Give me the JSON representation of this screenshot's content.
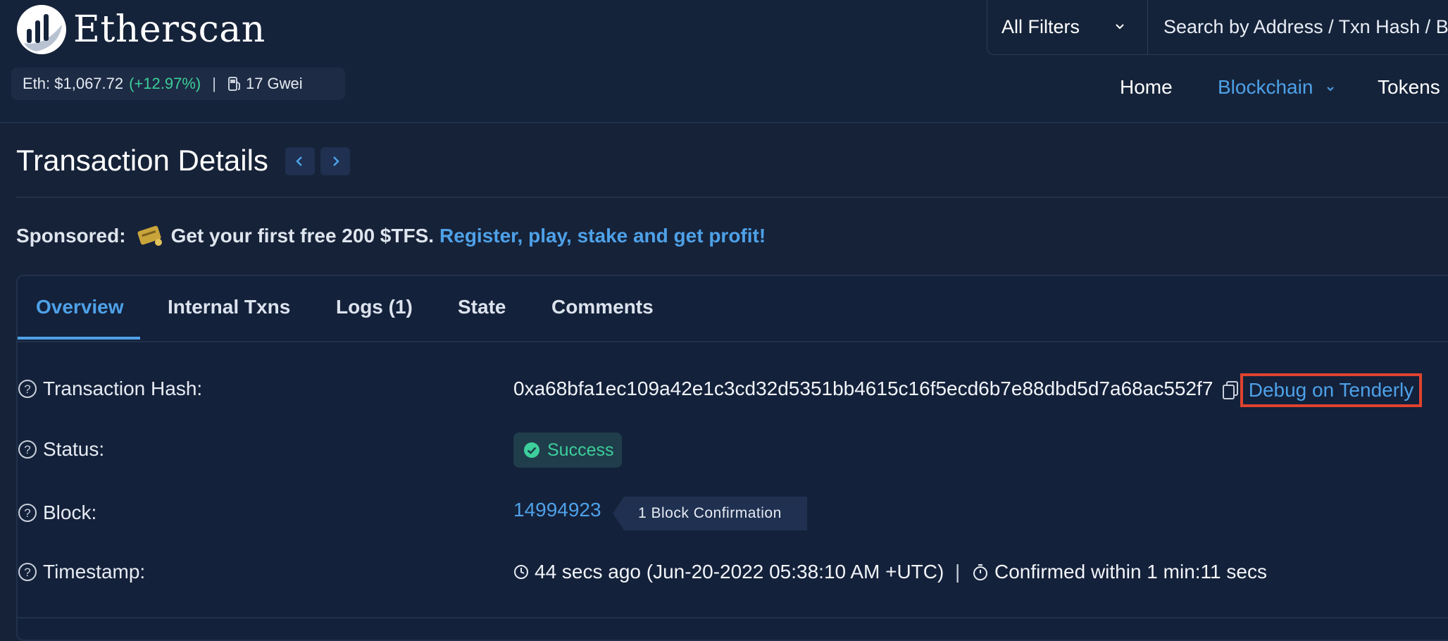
{
  "header": {
    "logo_text": "Etherscan",
    "eth_price": "Eth: $1,067.72",
    "eth_change": "(+12.97%)",
    "separator": "|",
    "gas": "17 Gwei",
    "filter_label": "All Filters",
    "search_placeholder": "Search by Address / Txn Hash / Block / Token / Ens",
    "nav": [
      {
        "label": "Home",
        "active": false
      },
      {
        "label": "Blockchain",
        "active": true
      },
      {
        "label": "Tokens",
        "active": false
      }
    ]
  },
  "page": {
    "title": "Transaction Details"
  },
  "sponsored": {
    "label": "Sponsored:",
    "text": "Get your first free 200 $TFS.",
    "link": "Register, play, stake and get profit!"
  },
  "tabs": [
    {
      "label": "Overview",
      "active": true
    },
    {
      "label": "Internal Txns",
      "active": false
    },
    {
      "label": "Logs (1)",
      "active": false
    },
    {
      "label": "State",
      "active": false
    },
    {
      "label": "Comments",
      "active": false
    }
  ],
  "details": {
    "hash_label": "Transaction Hash:",
    "hash_value": "0xa68bfa1ec109a42e1c3cd32d5351bb4615c16f5ecd6b7e88dbd5d7a68ac552f7",
    "debug_link": "Debug on Tenderly",
    "status_label": "Status:",
    "status_value": "Success",
    "block_label": "Block:",
    "block_value": "14994923",
    "block_confirmations": "1 Block Confirmation",
    "timestamp_label": "Timestamp:",
    "timestamp_value": "44 secs ago (Jun-20-2022 05:38:10 AM +UTC)",
    "timestamp_sep": "|",
    "confirmed_within": "Confirmed within 1 min:11 secs"
  },
  "colors": {
    "background": "#162238",
    "accent": "#4ea1e8",
    "success": "#3dcf9b",
    "highlight_box": "#e0432f"
  }
}
